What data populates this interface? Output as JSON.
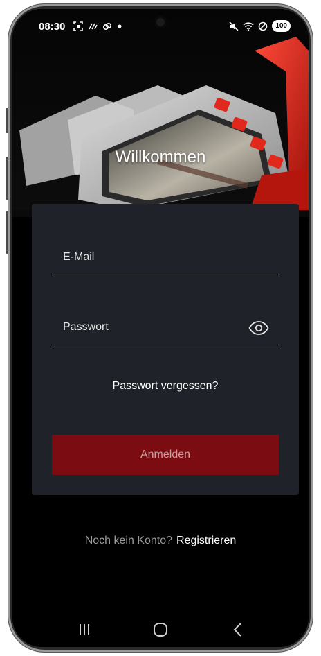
{
  "status_bar": {
    "time": "08:30",
    "battery": "100"
  },
  "hero": {
    "title": "Willkommen"
  },
  "login_form": {
    "email_label": "E-Mail",
    "password_label": "Passwort",
    "forgot_password": "Passwort vergessen?",
    "submit_label": "Anmelden"
  },
  "signup": {
    "question": "Noch kein Konto?",
    "link": "Registrieren"
  },
  "icons": {
    "password_toggle": "eye-icon",
    "nav_recents": "recents-icon",
    "nav_home": "home-icon",
    "nav_back": "back-icon"
  },
  "colors": {
    "background": "#000000",
    "card": "#1f2229",
    "button": "#7b0d12",
    "button_text": "#c9a0a2",
    "accent_red": "#d62a1e"
  }
}
